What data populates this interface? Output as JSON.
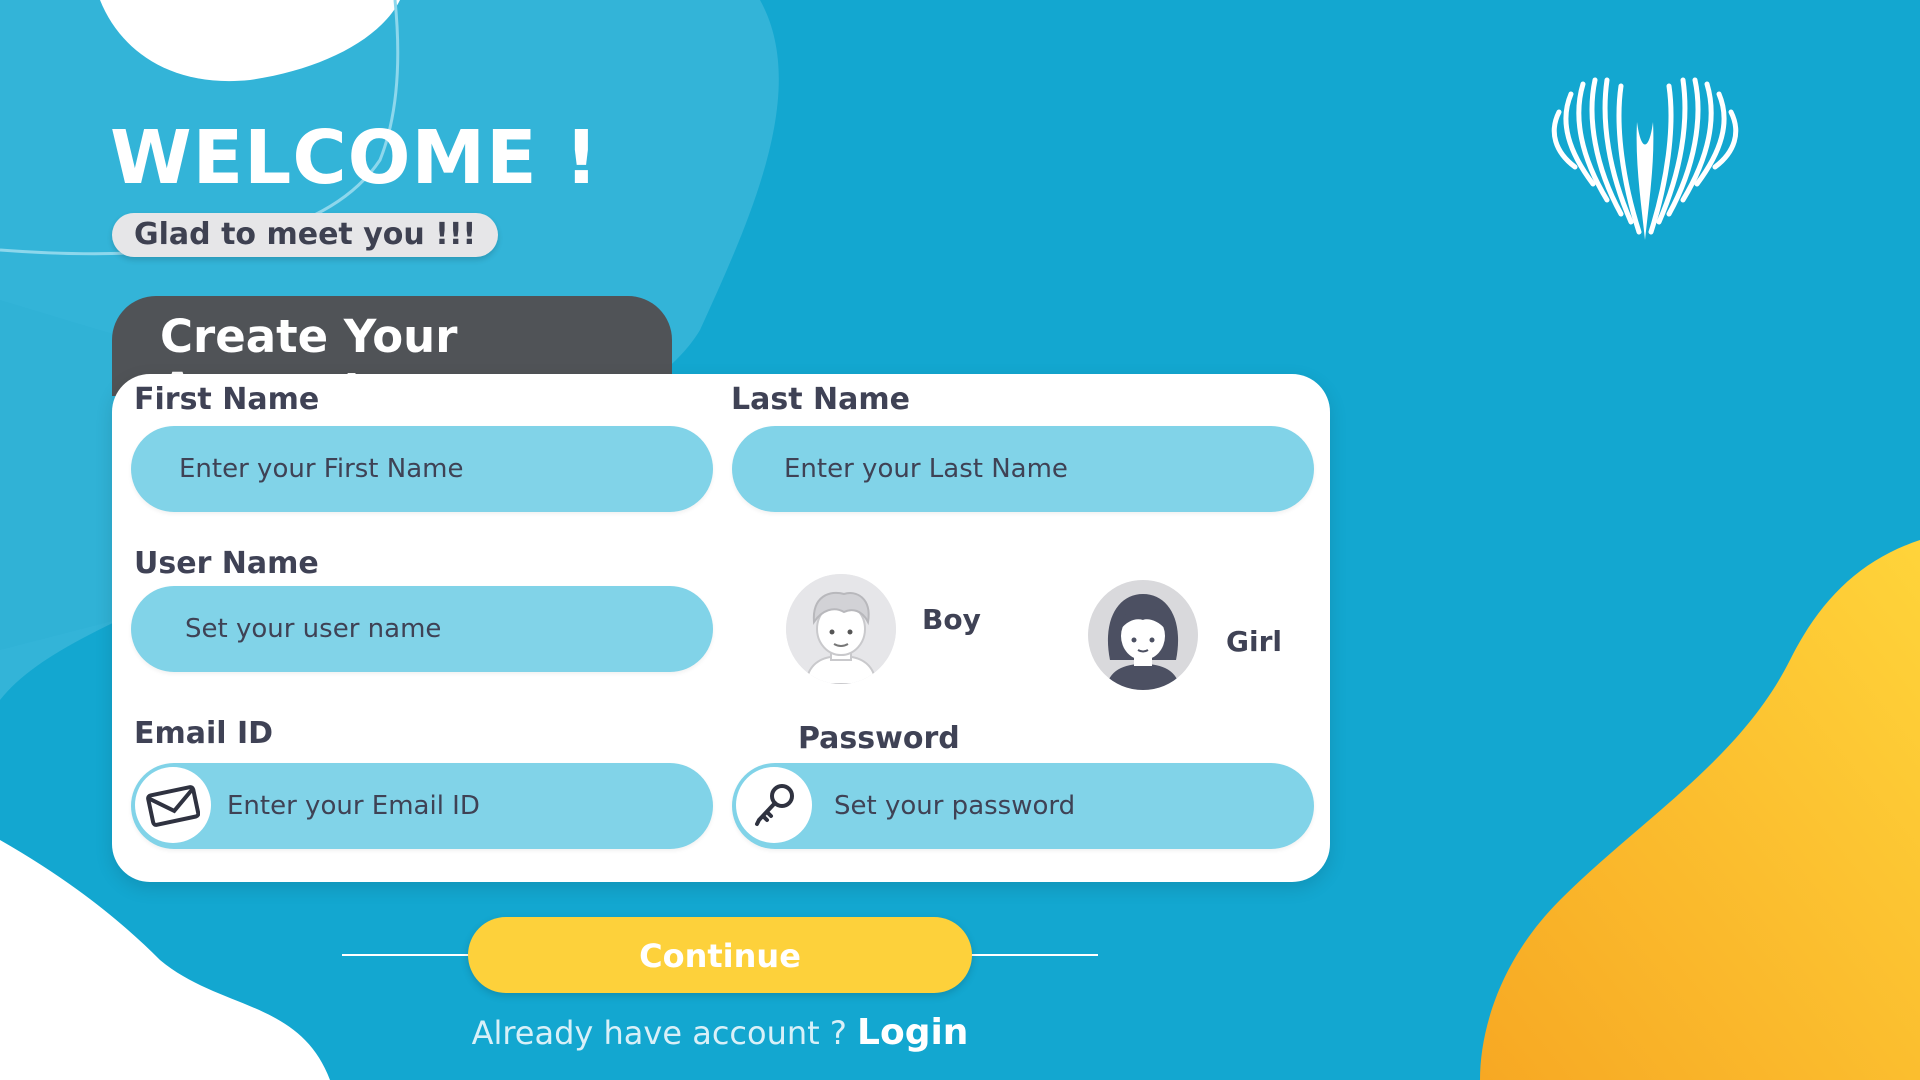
{
  "welcome": {
    "title": "WELCOME !",
    "subtitle": "Glad to meet you !!!"
  },
  "form": {
    "tab_title": "Create Your Account",
    "first_name": {
      "label": "First Name",
      "placeholder": "Enter your First Name",
      "value": ""
    },
    "last_name": {
      "label": "Last Name",
      "placeholder": "Enter your Last Name",
      "value": ""
    },
    "user_name": {
      "label": "User Name",
      "placeholder": "Set your user name",
      "value": ""
    },
    "email": {
      "label": "Email ID",
      "placeholder": "Enter your Email ID",
      "value": "",
      "icon": "envelope-icon"
    },
    "password": {
      "label": "Password",
      "placeholder": "Set your password",
      "value": "",
      "icon": "key-icon"
    },
    "gender": [
      {
        "label": "Boy",
        "icon": "boy-avatar-icon"
      },
      {
        "label": "Girl",
        "icon": "girl-avatar-icon"
      }
    ]
  },
  "actions": {
    "continue_label": "Continue",
    "login_prompt": "Already have account ?",
    "login_link": "Login"
  },
  "colors": {
    "background": "#13a7d0",
    "field": "#81d3e8",
    "tab": "#505357",
    "button": "#fdd13b",
    "accent_blob": "#fbbf24",
    "text_dark": "#3f4255"
  }
}
